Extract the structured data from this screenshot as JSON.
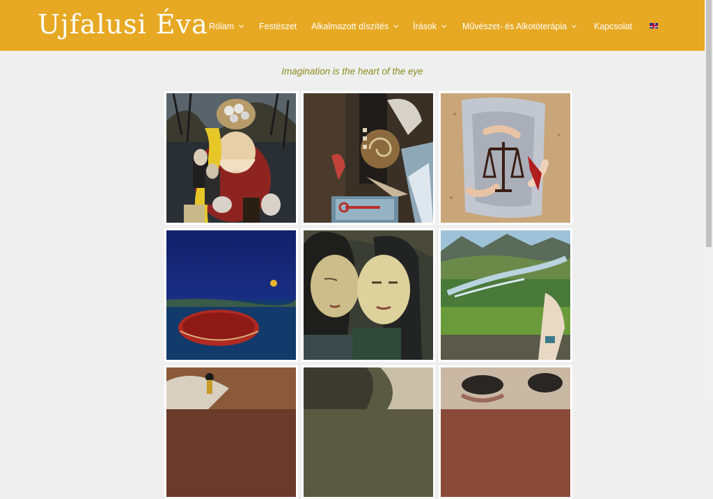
{
  "header": {
    "logo_text": "Ujfalusi Éva",
    "nav": [
      {
        "label": "Rólam",
        "has_dropdown": true
      },
      {
        "label": "Festészet",
        "has_dropdown": false
      },
      {
        "label": "Alkalmazott díszítés",
        "has_dropdown": true
      },
      {
        "label": "Írások",
        "has_dropdown": true
      },
      {
        "label": "Művészet- és Alkotóterápia",
        "has_dropdown": true
      },
      {
        "label": "Kapcsolat",
        "has_dropdown": false
      }
    ],
    "language_icon": "uk-flag-icon",
    "accent_color": "#e7a923"
  },
  "main": {
    "tagline": "Imagination is the heart of the eye",
    "tagline_color": "#8a8c1e",
    "gallery": {
      "columns": 3,
      "items": [
        {
          "name": "painting-surreal-portraits"
        },
        {
          "name": "painting-key-collage"
        },
        {
          "name": "painting-scales-fabric"
        },
        {
          "name": "painting-red-disc-night"
        },
        {
          "name": "painting-two-faces"
        },
        {
          "name": "painting-green-landscape"
        },
        {
          "name": "painting-row3-left"
        },
        {
          "name": "painting-row3-middle"
        },
        {
          "name": "painting-row3-right"
        }
      ]
    }
  }
}
